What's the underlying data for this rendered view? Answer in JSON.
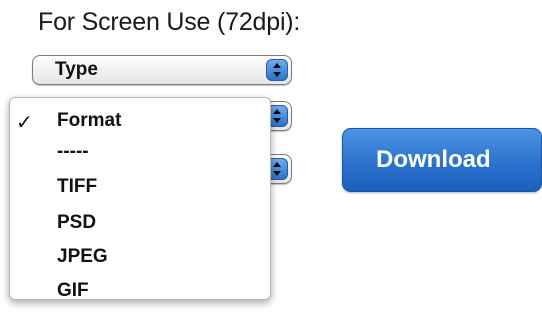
{
  "heading": "For Screen Use (72dpi):",
  "selects": [
    {
      "label": "Type",
      "icon": "stepper-icon"
    },
    {
      "label": "",
      "icon": "stepper-icon"
    },
    {
      "label": "",
      "icon": "stepper-icon"
    }
  ],
  "dropdown": {
    "check_glyph": "✓",
    "options": [
      "Format",
      "-----",
      "TIFF",
      "PSD",
      "JPEG",
      "GIF"
    ],
    "selected": "Format"
  },
  "download_label": "Download",
  "colors": {
    "button_blue": "#2a72ce",
    "stepper_blue": "#3f86e0"
  }
}
